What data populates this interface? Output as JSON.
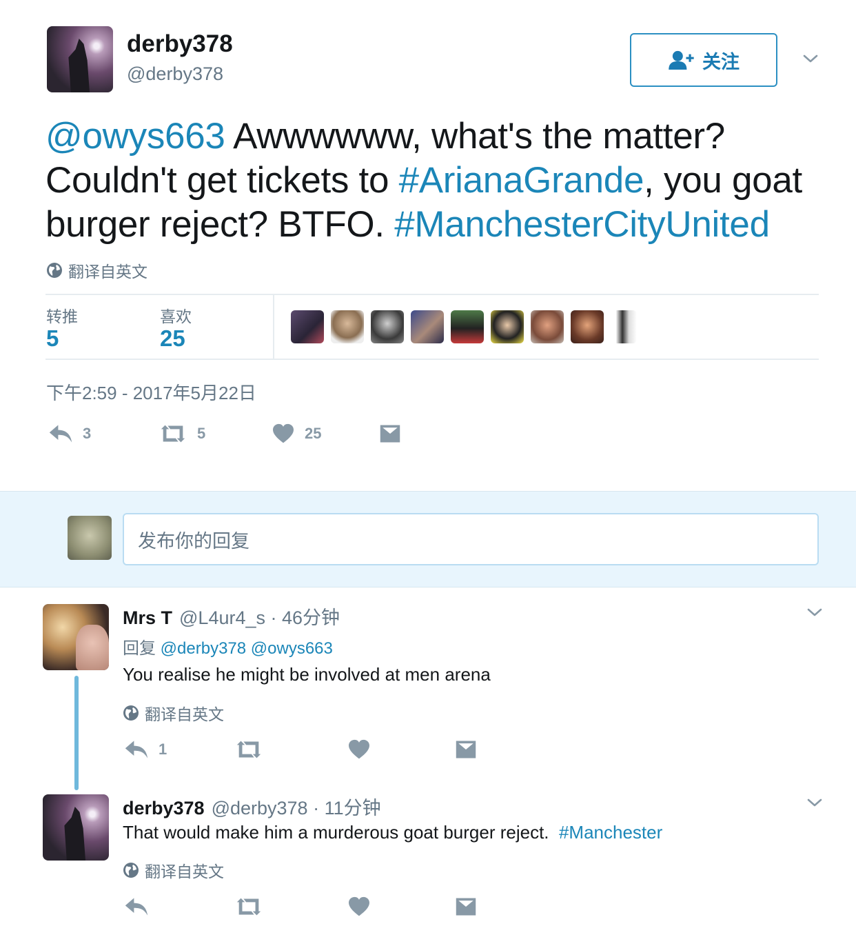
{
  "tweet": {
    "display_name": "derby378",
    "handle": "@derby378",
    "follow_label": "关注",
    "text_parts": {
      "mention": "@owys663",
      "t1": " Awwwwww, what's the matter? Couldn't get tickets to ",
      "tag1": "#ArianaGrande",
      "t2": ", you goat burger reject?  BTFO. ",
      "tag2": "#ManchesterCityUnited"
    },
    "translate_label": "翻译自英文",
    "stats": {
      "retweets_label": "转推",
      "retweets": "5",
      "likes_label": "喜欢",
      "likes": "25"
    },
    "timestamp": "下午2:59 - 2017年5月22日",
    "actions": {
      "reply_count": "3",
      "retweet_count": "5",
      "like_count": "25"
    }
  },
  "reply_box": {
    "placeholder": "发布你的回复"
  },
  "replies": [
    {
      "name": "Mrs T",
      "handle_time": "@L4ur4_s · 46分钟",
      "reply_to_label": "回复",
      "reply_to": "@derby378 @owys663",
      "text": "You realise he might be involved at men arena",
      "translate_label": "翻译自英文",
      "reply_count": "1"
    },
    {
      "name": "derby378",
      "handle_time": "@derby378 · 11分钟",
      "text": "That would make him a murderous goat burger reject.  ",
      "tag": "#Manchester",
      "translate_label": "翻译自英文"
    }
  ],
  "colors": {
    "link": "#1b86b8",
    "muted": "#657786",
    "icon": "#8899a6",
    "thread": "#6fb8dc"
  }
}
